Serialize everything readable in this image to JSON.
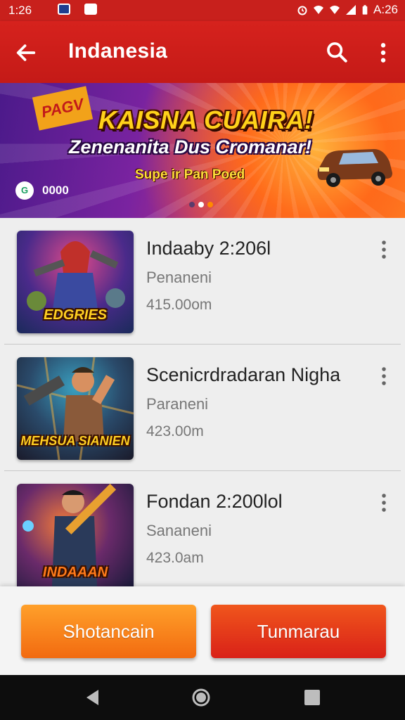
{
  "status_bar": {
    "time_left": "1:26",
    "time_right": "A:26"
  },
  "app_bar": {
    "title": "Indanesia",
    "icons": [
      "back-arrow-icon",
      "search-icon",
      "more-vert-icon"
    ]
  },
  "banner": {
    "tag": "PAGV",
    "headline": "KAISNA CUAIRA!",
    "subheadline": "Zenenanita Dus Cromanar!",
    "tagline": "Supe ir Pan Poed",
    "logo_text": "0000",
    "carousel": {
      "pages": 3,
      "active": 1
    }
  },
  "items": [
    {
      "title": "Indaaby 2:206l",
      "subtitle": "Penaneni",
      "size": "415.00om",
      "thumb_caption": "EDGRIES"
    },
    {
      "title": "Scenicrdradaran Nigha",
      "subtitle": "Paraneni",
      "size": "423.00m",
      "thumb_caption": "MEHSUA SIANIEN"
    },
    {
      "title": "Fondan 2:200lol",
      "subtitle": "Sananeni",
      "size": "423.0am",
      "thumb_caption": "INDAAAN"
    }
  ],
  "footer": {
    "left_button": "Shotancain",
    "right_button": "Tunmarau"
  },
  "colors": {
    "primary": "#c8201c",
    "accent_orange": "#f26a10",
    "accent_red": "#d92118"
  }
}
